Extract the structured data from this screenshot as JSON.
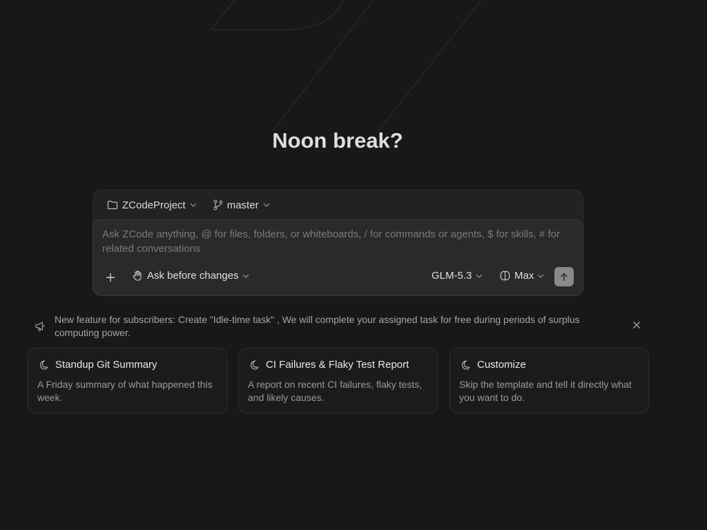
{
  "greeting": "Noon break?",
  "composer": {
    "project": {
      "label": "ZCodeProject",
      "icon": "folder-icon"
    },
    "branch": {
      "label": "master",
      "icon": "git-branch-icon"
    },
    "placeholder": "Ask ZCode anything, @ for files, folders, or whiteboards, / for commands or agents, $ for skills, # for related conversations",
    "value": "",
    "mode": {
      "label": "Ask before changes",
      "icon": "hand-icon"
    },
    "model": {
      "label": "GLM-5.3"
    },
    "effort": {
      "label": "Max",
      "icon": "brain-icon"
    },
    "send_icon": "arrow-up-icon"
  },
  "notice": {
    "text": "New feature for subscribers: Create \"Idle-time task\" , We will complete your assigned task for free during periods of surplus computing power.",
    "icon": "megaphone-icon"
  },
  "cards": [
    {
      "title": "Standup Git Summary",
      "description": "A Friday summary of what happened this week.",
      "icon": "moon-icon"
    },
    {
      "title": "CI Failures & Flaky Test Report",
      "description": "A report on recent CI failures, flaky tests, and likely causes.",
      "icon": "moon-icon"
    },
    {
      "title": "Customize",
      "description": "Skip the template and tell it directly what you want to do.",
      "icon": "moon-icon"
    }
  ],
  "colors": {
    "background": "#181818",
    "composer": "#222222",
    "input_panel": "#2a2a2a",
    "send_button": "#8a8a8a"
  }
}
